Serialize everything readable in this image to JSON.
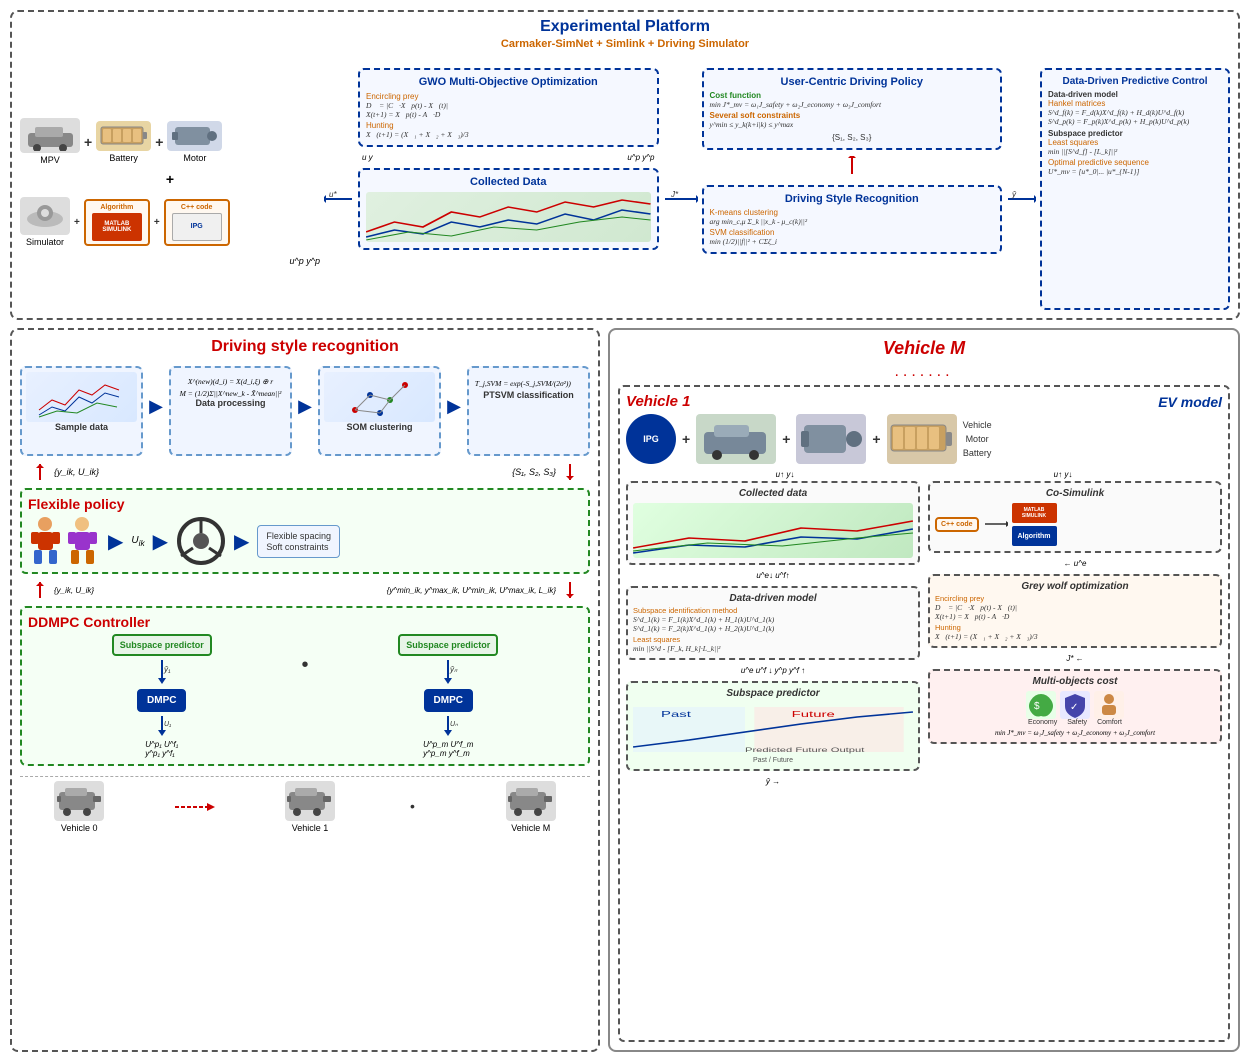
{
  "top": {
    "title": "Experimental Platform",
    "subtitle": "Carmaker-SimNet + Simlink + Driving Simulator",
    "mpv_label": "MPV",
    "battery_label": "Battery",
    "motor_label": "Motor",
    "simulator_label": "Simulator",
    "algorithm_label": "Algorithm",
    "cpp_label": "C++ code",
    "gwo": {
      "title": "GWO Multi-Objective Optimization",
      "subtitle1": "Encircling prey",
      "formula1": "D⃗ = |C⃗·X⃗p(t) - X⃗(t)|",
      "formula2": "X(t+1) = X⃗p(t) - A⃗·D⃗",
      "subtitle2": "Hunting",
      "formula3": "X⃗(t+1) = (X⃗₁ + X⃗₂ + X⃗₃)/3"
    },
    "collected": {
      "title": "Collected Data"
    },
    "user_centric": {
      "title": "User-Centric Driving Policy",
      "subtitle": "Cost function",
      "formula": "min J*_mv = ω₁J_safety + ω₂J_economy + ω₃J_comfort",
      "constraints": "Several soft constraints",
      "sets": "{S₁, S₂, S₃}"
    },
    "driving_style_rec": {
      "title": "Driving Style Recognition",
      "subtitle1": "K-means clustering",
      "subtitle2": "SVM classification"
    },
    "data_driven": {
      "title": "Data-Driven Predictive Control",
      "subtitle": "Data-driven model",
      "hankel": "Hankel matrices",
      "subspace": "Subspace predictor",
      "least_squares": "Least squares",
      "optimal_seq": "Optimal predictive sequence"
    },
    "signal_u_star": "u*",
    "signal_j_star": "J*",
    "signal_y_hat": "ŷ",
    "signal_u_p_yp": "u^p y^p",
    "signal_u_p_yp2": "u^p y^p"
  },
  "bottom_left": {
    "title": "Driving style recognition",
    "recognition_steps": [
      {
        "label": "Sample data",
        "has_chart": true
      },
      {
        "label": "Data processing",
        "formula": "M = (1/2)Σ||X^(new)_i - X^(mean)||²"
      },
      {
        "label": "SOM clustering",
        "has_graph": true
      },
      {
        "label": "PTSVM classification"
      }
    ],
    "input_signal": "{y_ik, U_ik}",
    "output_signal": "{S₁, S₂, S₃}",
    "flexible_policy": {
      "label": "Flexible policy",
      "bullets": [
        "Flexible spacing",
        "Soft constraints"
      ],
      "input": "{y_ik, U_ik}",
      "output": "{y^min_ik, y^max_ik, U^min_ik, U^max_ik, L_ik}"
    },
    "ddmpc": {
      "label": "DDMPC Controller",
      "subspace1": "Subspace predictor",
      "subspace2": "Subspace predictor",
      "dmpc": "DMPC"
    },
    "vehicles": [
      {
        "label": "Vehicle 0"
      },
      {
        "label": "Vehicle 1"
      },
      {
        "label": "Vehicle M"
      }
    ],
    "dots": "•"
  },
  "bottom_right": {
    "vehicle_m_title": "Vehicle M",
    "dots": ".......",
    "vehicle1_title": "Vehicle 1",
    "ev_model_title": "EV model",
    "ipg_label": "IPG",
    "vehicle_label": "Vehicle",
    "motor_label": "Motor",
    "battery_label": "Battery",
    "collected_data": {
      "title": "Collected data"
    },
    "co_simulink": {
      "title": "Co-Simulink",
      "cpp_label": "C++ code",
      "algo_label": "Algorithm"
    },
    "data_driven_model": {
      "title": "Data-driven model",
      "subtitle": "Subspace identification method",
      "formula1": "S^d_1(k) = F_1(k)X^d_1(k) + H_1(k)U^d_1(k)",
      "formula2": "S^d_1(k) = F_2(k)X^d_1(k) + H_2(k)U^d_1(k)",
      "least_squares": "Least squares",
      "formula3": "min ||S^d - [F_k, H_k]·L_k||²"
    },
    "grey_wolf": {
      "title": "Grey wolf optimization",
      "encircling": "Encircling prey",
      "formula1": "D⃗ = |C⃗·X⃗p(t) - X⃗(t)|",
      "formula2": "X(t+1) = X⃗p(t) - A⃗·D⃗",
      "hunting": "Hunting",
      "formula3": "X⃗(t+1) = (X⃗₁ + X⃗₂ + X⃗₃)/3",
      "signal": "J*"
    },
    "subspace_predictor": {
      "title": "Subspace predictor",
      "past_future": "Past / Future"
    },
    "multi_objects": {
      "title": "Multi-objects cost",
      "icons": [
        "Economy",
        "Safety",
        "Comfort"
      ],
      "formula": "min J*_mv = ω₁J_safety + ω₂J_economy + ω₃J_comfort"
    },
    "signals": {
      "u1": "u↑",
      "y1": "y↑",
      "u2": "u↑",
      "y2": "y↑",
      "ue": "u^e",
      "ue2": "u^e",
      "yp": "y^p",
      "yp2": "y^p",
      "j_star": "J*",
      "y_hat": "ŷ"
    }
  }
}
